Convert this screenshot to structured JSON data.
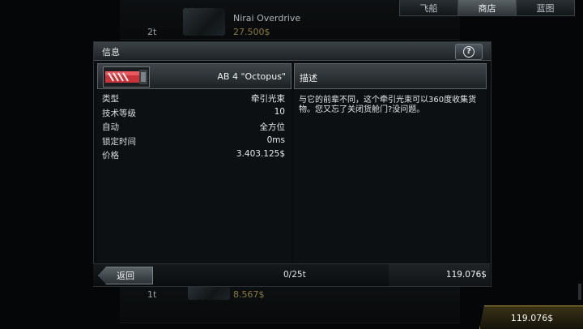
{
  "background_list": [
    {
      "count": "2t",
      "name": "Nirai Overdrive",
      "price": "27.500$"
    },
    {
      "count": "1t",
      "name": "",
      "price": "8.567$"
    }
  ],
  "tabs": [
    {
      "label": "飞船",
      "active": false
    },
    {
      "label": "商店",
      "active": true
    },
    {
      "label": "蓝图",
      "active": false
    }
  ],
  "dialog": {
    "title": "信息",
    "help_icon": "question-mark-icon",
    "item": {
      "name": "AB 4 \"Octopus\"",
      "icon": "tractor-beam-module-icon",
      "stats": [
        {
          "label": "类型",
          "value": "牵引光束"
        },
        {
          "label": "技术等级",
          "value": "10"
        },
        {
          "label": "自动",
          "value": "全方位"
        },
        {
          "label": "锁定时间",
          "value": "0ms"
        },
        {
          "label": "价格",
          "value": "3.403.125$"
        }
      ]
    },
    "description": {
      "title": "描述",
      "text": "与它的前辈不同，这个牵引光束可以360度收集货物。您又忘了关闭货舱门?没问题。"
    }
  },
  "footer": {
    "back_label": "返回",
    "page_indicator": "0/25t",
    "funds": "119.076$"
  },
  "money_tab": {
    "funds": "119.076$"
  },
  "colors": {
    "accent_gold": "#b39a3a",
    "panel": "#0c1012"
  }
}
